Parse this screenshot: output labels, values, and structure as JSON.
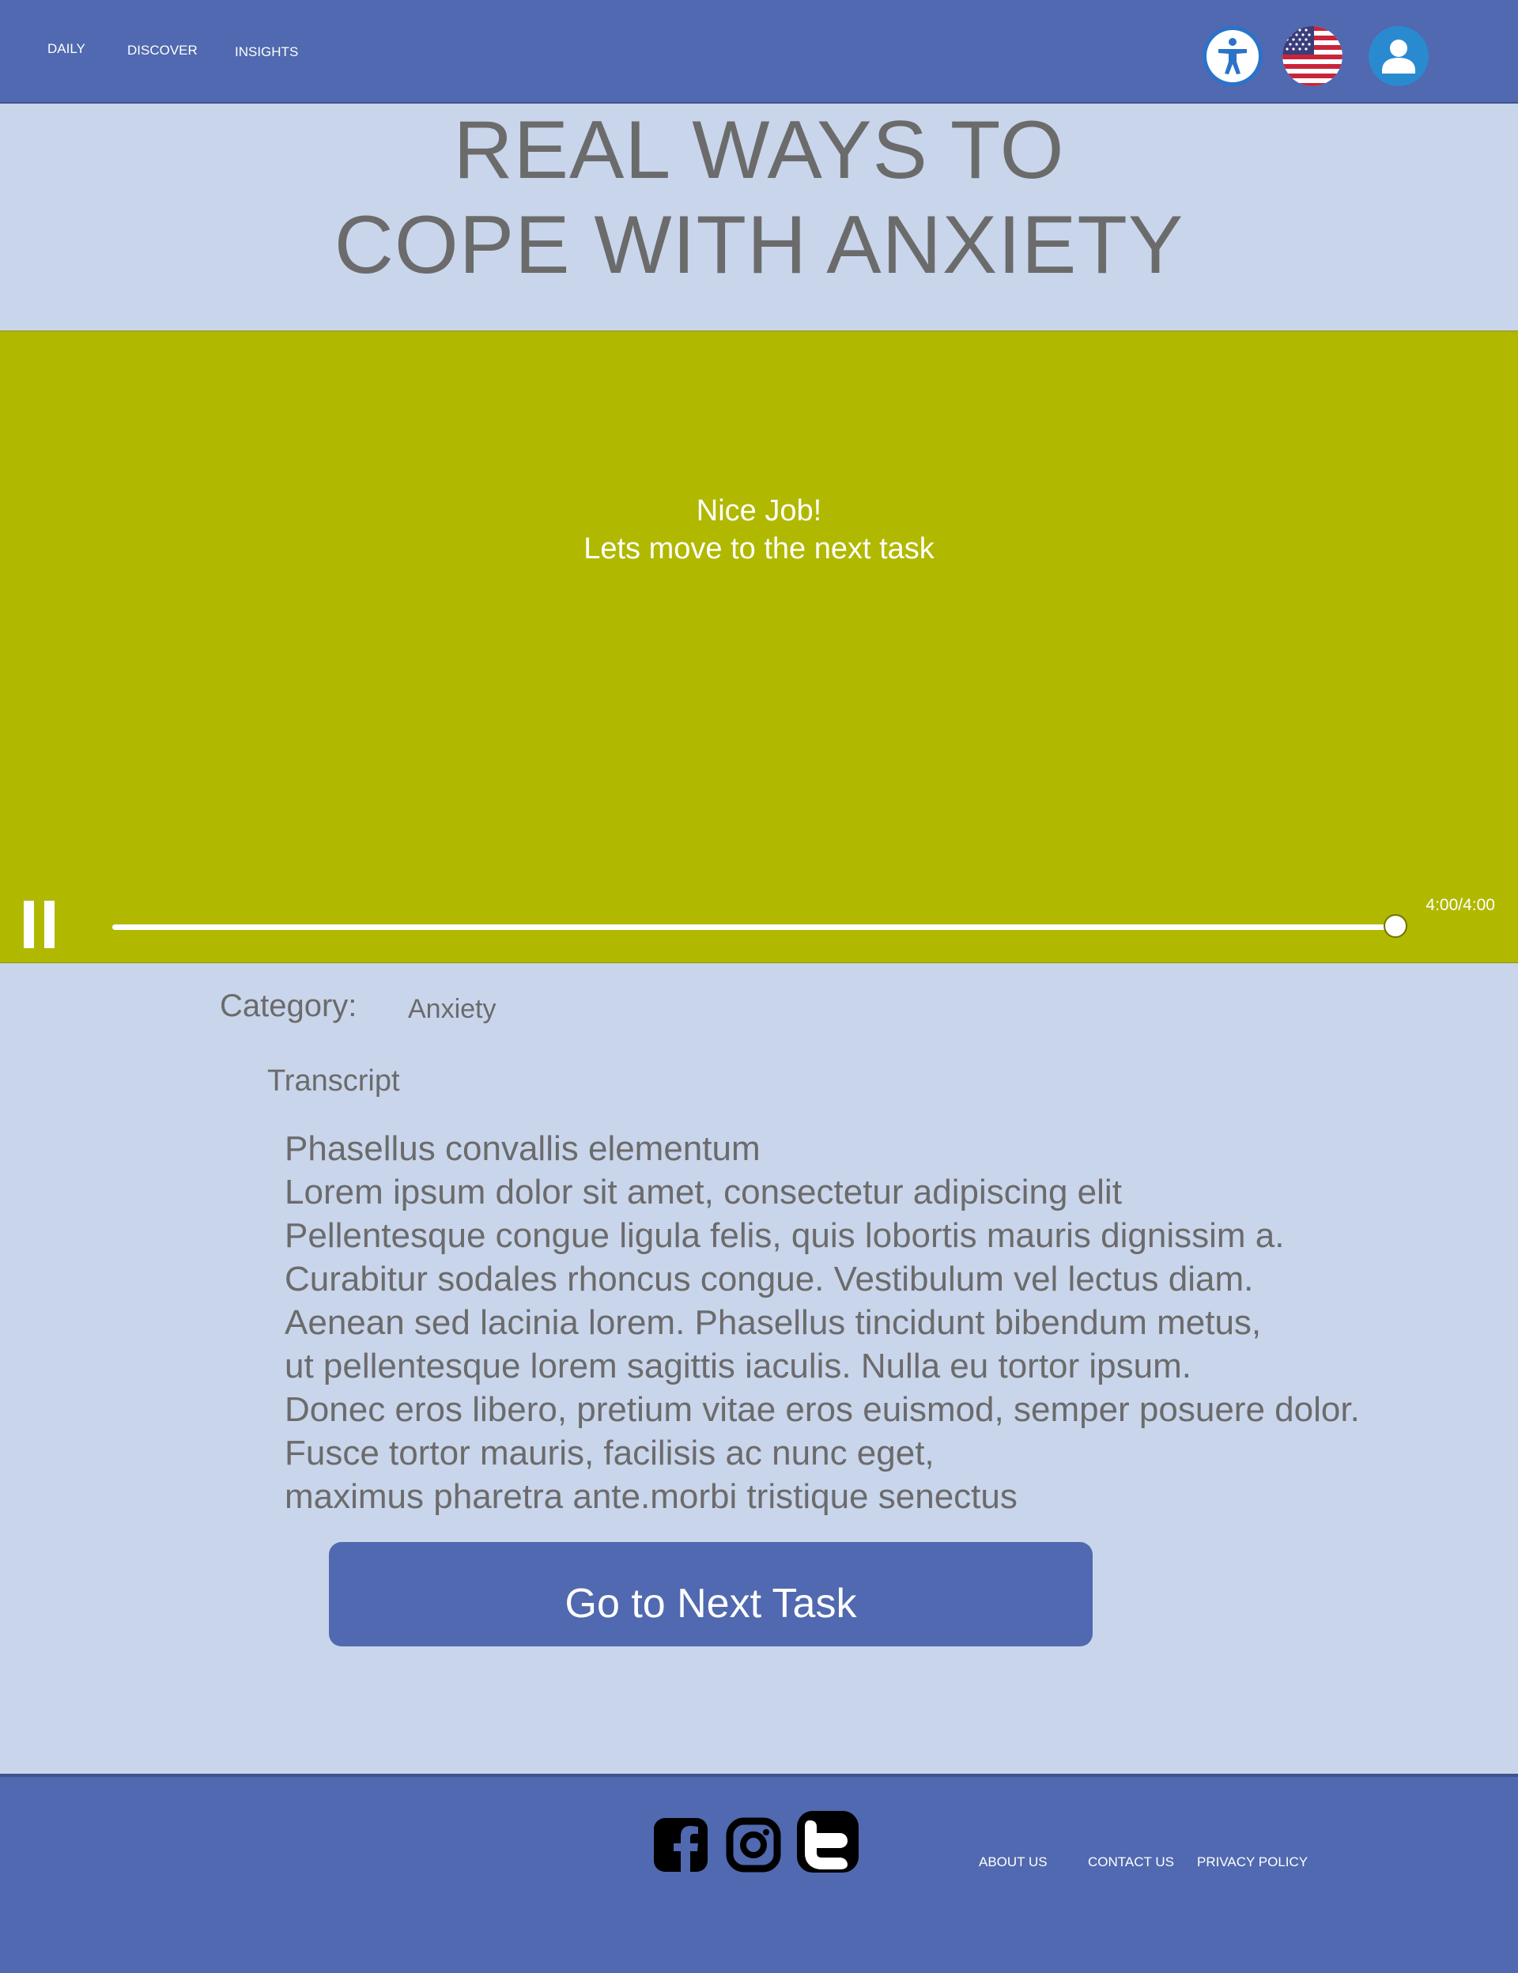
{
  "nav": {
    "items": [
      {
        "label": "DAILY"
      },
      {
        "label": "DISCOVER"
      },
      {
        "label": "INSIGHTS"
      }
    ]
  },
  "header_icons": [
    "accessibility-icon",
    "us-flag-icon",
    "user-profile-icon"
  ],
  "title": {
    "line1": "REAL WAYS TO",
    "line2": "COPE WITH ANXIETY"
  },
  "player": {
    "message_line1": "Nice Job!",
    "message_line2": "Lets move to the next task",
    "time": "4:00/4:00",
    "progress": 1.0,
    "background": "#b0b800"
  },
  "category": {
    "label": "Category:",
    "value": "Anxiety"
  },
  "transcript": {
    "heading": "Transcript",
    "lines": [
      "Phasellus convallis elementum",
      "Lorem ipsum dolor sit amet, consectetur adipiscing elit",
      "Pellentesque congue ligula felis, quis lobortis mauris dignissim a.",
      "Curabitur sodales rhoncus congue. Vestibulum vel lectus diam.",
      "Aenean sed lacinia lorem. Phasellus tincidunt bibendum metus,",
      "ut pellentesque lorem sagittis iaculis. Nulla eu tortor ipsum.",
      "Donec eros libero, pretium vitae eros euismod, semper posuere dolor.",
      "Fusce tortor mauris, facilisis ac nunc eget,",
      "maximus pharetra ante.morbi tristique senectus"
    ]
  },
  "next_button": {
    "label": "Go to Next Task"
  },
  "footer": {
    "social": [
      "facebook-icon",
      "instagram-icon",
      "twitter-icon"
    ],
    "links": [
      {
        "label": "ABOUT US"
      },
      {
        "label": "CONTACT US"
      },
      {
        "label": "PRIVACY POLICY"
      }
    ]
  },
  "colors": {
    "header": "#5069b0",
    "page_background": "#c9d5eb",
    "text": "#6b6b6b",
    "accent": "#5069b0"
  }
}
